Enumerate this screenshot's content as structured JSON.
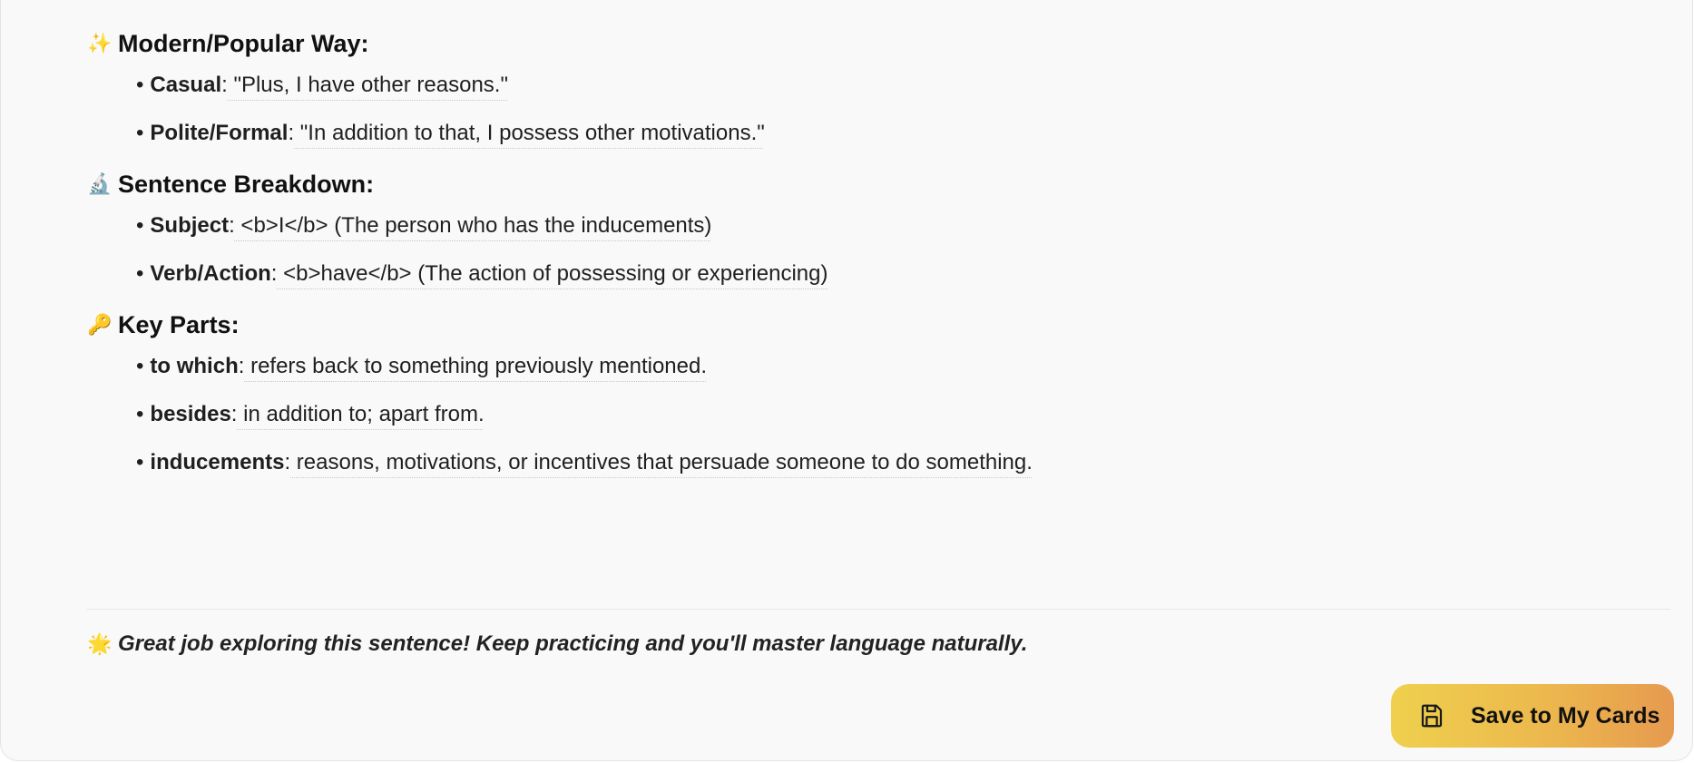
{
  "sections": [
    {
      "icon": "sparkles-icon",
      "icon_glyph": "✨",
      "title": "Modern/Popular Way:",
      "items": [
        {
          "term": "Casual",
          "sep": ":",
          "text": " \"Plus, I have other reasons.\""
        },
        {
          "term": "Polite/Formal",
          "sep": ":",
          "text": " \"In addition to that, I possess other motivations.\""
        }
      ]
    },
    {
      "icon": "microscope-icon",
      "icon_glyph": "🔬",
      "title": "Sentence Breakdown:",
      "items": [
        {
          "term": "Subject",
          "sep": ":",
          "text": " <b>I</b> (The person who has the inducements)"
        },
        {
          "term": "Verb/Action",
          "sep": ":",
          "text": " <b>have</b> (The action of possessing or experiencing)"
        }
      ]
    },
    {
      "icon": "key-icon",
      "icon_glyph": "🔑",
      "title": "Key Parts:",
      "items": [
        {
          "term": "to which",
          "sep": ":",
          "text": " refers back to something previously mentioned."
        },
        {
          "term": "besides",
          "sep": ":",
          "text": " in addition to; apart from."
        },
        {
          "term": "inducements",
          "sep": ":",
          "text": " reasons, motivations, or incentives that persuade someone to do something."
        }
      ]
    }
  ],
  "closing": {
    "icon": "sparkle-burst-icon",
    "icon_glyph": "🌟",
    "text": "Great job exploring this sentence! Keep practicing and you'll master language naturally."
  },
  "save_button": {
    "icon": "save-icon",
    "label": "Save to My Cards"
  },
  "colors": {
    "panel_bg": "#f9f9f9",
    "button_gradient_start": "#efd04d",
    "button_gradient_end": "#e69a4f"
  }
}
